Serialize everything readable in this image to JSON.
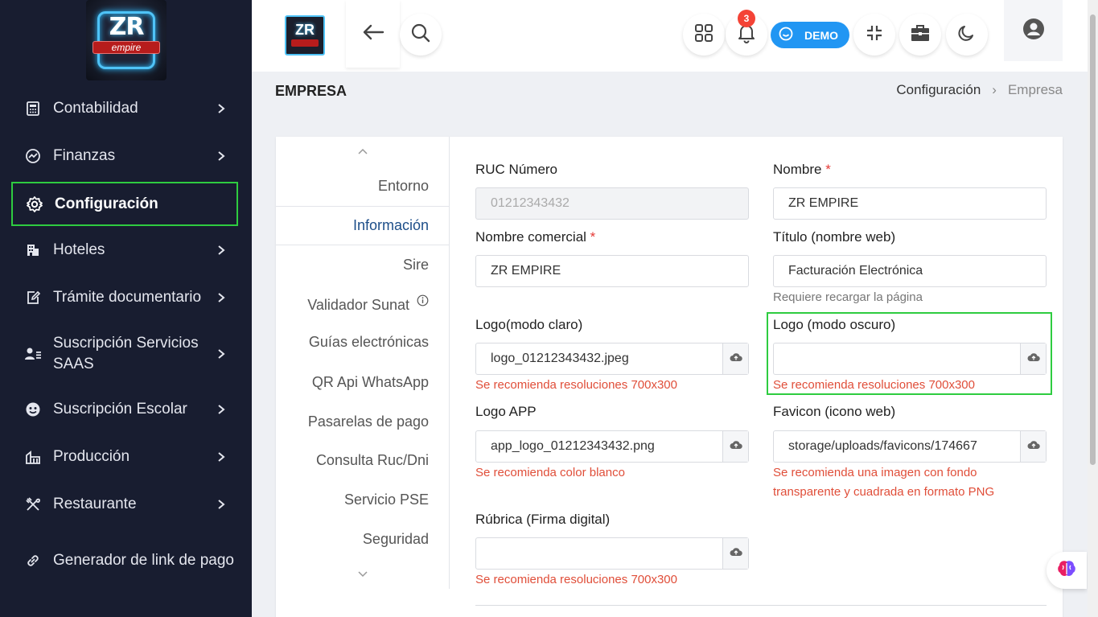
{
  "brand": {
    "logo_main": "ZR",
    "logo_sub": "empire"
  },
  "sidebar": {
    "items": [
      {
        "label": "Contabilidad"
      },
      {
        "label": "Finanzas"
      },
      {
        "label": "Configuración"
      },
      {
        "label": "Hoteles"
      },
      {
        "label": "Trámite documentario"
      },
      {
        "label": "Suscripción Servicios SAAS"
      },
      {
        "label": "Suscripción Escolar"
      },
      {
        "label": "Producción"
      },
      {
        "label": "Restaurante"
      },
      {
        "label": "Generador de link de pago"
      }
    ]
  },
  "topbar": {
    "notifications_count": "3",
    "demo_label": "DEMO"
  },
  "page": {
    "title": "EMPRESA",
    "breadcrumb": [
      "Configuración",
      "Empresa"
    ]
  },
  "tabs": [
    "Entorno",
    "Información",
    "Sire",
    "Validador Sunat",
    "Guías electrónicas",
    "QR Api WhatsApp",
    "Pasarelas de pago",
    "Consulta Ruc/Dni",
    "Servicio PSE",
    "Seguridad"
  ],
  "form": {
    "ruc": {
      "label": "RUC Número",
      "value": "01212343432"
    },
    "nombre": {
      "label": "Nombre",
      "value": "ZR EMPIRE"
    },
    "nombre_comercial": {
      "label": "Nombre comercial",
      "value": "ZR EMPIRE"
    },
    "titulo": {
      "label": "Título (nombre web)",
      "value": "Facturación Electrónica",
      "hint": "Requiere recargar la página"
    },
    "logo_claro": {
      "label": "Logo(modo claro)",
      "value": "logo_01212343432.jpeg",
      "hint": "Se recomienda resoluciones 700x300"
    },
    "logo_oscuro": {
      "label": "Logo (modo oscuro)",
      "value": "",
      "hint": "Se recomienda resoluciones 700x300"
    },
    "logo_app": {
      "label": "Logo APP",
      "value": "app_logo_01212343432.png",
      "hint": "Se recomienda color blanco"
    },
    "favicon": {
      "label": "Favicon (icono web)",
      "value": "storage/uploads/favicons/174667",
      "hint1": "Se recomienda una imagen con fondo",
      "hint2": "transparente y cuadrada en formato PNG"
    },
    "rubrica": {
      "label": "Rúbrica (Firma digital)",
      "value": "",
      "hint": "Se recomienda resoluciones 700x300"
    },
    "required_mark": "*"
  },
  "colors": {
    "sidebar_bg": "#181d30",
    "highlight": "#2ecc40",
    "accent": "#2196f3",
    "hint": "#e04e39"
  }
}
